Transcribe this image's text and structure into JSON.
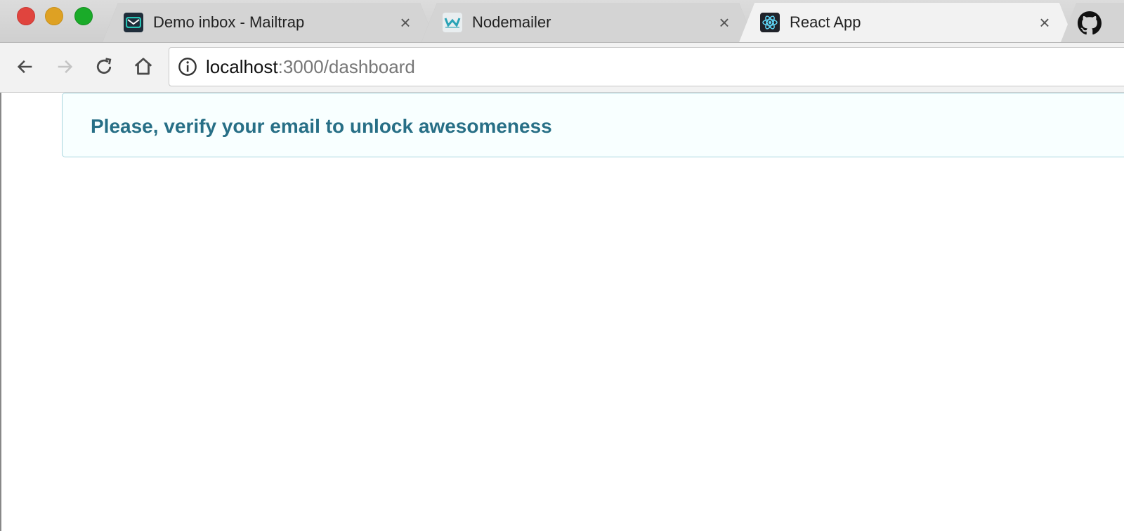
{
  "browser": {
    "tabs": [
      {
        "title": "Demo inbox - Mailtrap",
        "favicon": "mailtrap-icon",
        "close": "×",
        "active": false
      },
      {
        "title": "Nodemailer",
        "favicon": "nodemailer-icon",
        "close": "×",
        "active": false
      },
      {
        "title": "React App",
        "favicon": "react-icon",
        "close": "×",
        "active": true
      }
    ],
    "partial_tab_icon": "github-icon",
    "address": {
      "host": "localhost",
      "path": ":3000/dashboard"
    }
  },
  "page": {
    "alert": {
      "message": "Please, verify your email to unlock awesomeness",
      "color": "#276f86",
      "background": "#f8ffff",
      "border": "#a9d5de"
    }
  }
}
